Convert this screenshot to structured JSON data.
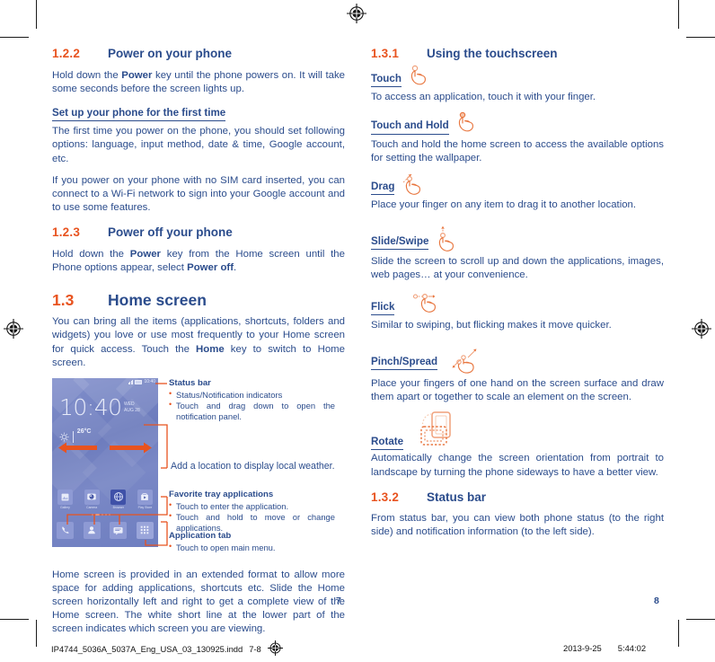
{
  "document": {
    "left_page_number": "7",
    "right_page_number": "8",
    "footer_filename": "IP4744_5036A_5037A_Eng_USA_03_130925.indd",
    "footer_pages": "7-8",
    "footer_date": "2013-9-25",
    "footer_time": "5:44:02"
  },
  "colors": {
    "heading_number": "#E8531F",
    "heading_title": "#2B4C8C",
    "body_text": "#2B4C8C",
    "accent_orange": "#E8531F",
    "phone_screen": "#6E7EC0"
  },
  "left_column": {
    "section_122": {
      "number": "1.2.2",
      "title": "Power on your phone",
      "para1_a": "Hold down the ",
      "para1_b": "Power",
      "para1_c": " key until the phone powers on. It will take some seconds before the screen lights up.",
      "subheading": "Set up your phone for the first time",
      "para2": "The first time you power on the phone, you should set following options: language, input method, date & time, Google account, etc.",
      "para3": "If you power on your phone with no SIM card inserted, you can connect to a Wi-Fi network to sign into your Google account and to use some features."
    },
    "section_123": {
      "number": "1.2.3",
      "title": "Power off your phone",
      "para1_a": "Hold down the ",
      "para1_b": "Power",
      "para1_c": " key from the Home screen until the Phone options appear, select ",
      "para1_d": "Power off",
      "para1_e": "."
    },
    "section_13": {
      "number": "1.3",
      "title": "Home screen",
      "para1_a": "You can bring all the items (applications, shortcuts, folders and widgets) you love or use most frequently to your Home screen for quick access. Touch the ",
      "para1_b": "Home",
      "para1_c": " key to switch to Home screen."
    },
    "closing_paragraph": "Home screen is provided in an extended format to allow more space for adding applications, shortcuts etc. Slide the Home screen horizontally left and right to get a complete view of the Home screen. The white short line at the lower part of the screen indicates which screen you are viewing."
  },
  "phone_mockup": {
    "status_time": "10:40",
    "clock": "10:40",
    "date_line1": "WED",
    "date_line2": "AUG 28",
    "weather_temp": "26°C",
    "weather_condition": "Sunny",
    "app_row": [
      {
        "label": "Gallery",
        "icon": "gallery-icon"
      },
      {
        "label": "Camera",
        "icon": "camera-icon"
      },
      {
        "label": "Browser",
        "icon": "browser-icon"
      },
      {
        "label": "Play Store",
        "icon": "play-store-icon"
      }
    ],
    "tray": [
      {
        "label": "Phone",
        "icon": "phone-icon"
      },
      {
        "label": "Contacts",
        "icon": "contacts-icon"
      },
      {
        "label": "Messaging",
        "icon": "messaging-icon"
      },
      {
        "label": "Application tab",
        "icon": "app-drawer-icon"
      }
    ]
  },
  "callouts": {
    "status_bar": {
      "title": "Status bar",
      "bullets": [
        "Status/Notification indicators",
        "Touch and drag down to open the notification panel."
      ]
    },
    "weather": {
      "text": "Add a location to display local weather."
    },
    "favorite_tray": {
      "title": "Favorite tray applications",
      "bullets": [
        "Touch to enter the application.",
        "Touch and hold to move or change applications."
      ]
    },
    "application_tab": {
      "title": "Application tab",
      "bullets": [
        "Touch to open main menu."
      ]
    }
  },
  "right_column": {
    "section_131": {
      "number": "1.3.1",
      "title": "Using the touchscreen"
    },
    "gestures": [
      {
        "name": "Touch",
        "icon": "touch-hand-icon",
        "description": "To access an application, touch it with your finger."
      },
      {
        "name": "Touch and Hold",
        "icon": "touch-hold-hand-icon",
        "description": "Touch and hold the home screen to access the available options for setting the wallpaper."
      },
      {
        "name": "Drag",
        "icon": "drag-hand-icon",
        "description": "Place your finger on any item to drag it to another location."
      },
      {
        "name": "Slide/Swipe",
        "icon": "slide-hand-icon",
        "description": "Slide the screen to scroll up and down the applications, images, web pages… at your convenience."
      },
      {
        "name": "Flick",
        "icon": "flick-hand-icon",
        "description": "Similar to swiping, but flicking makes it move quicker."
      },
      {
        "name": "Pinch/Spread",
        "icon": "pinch-spread-hand-icon",
        "description": "Place your fingers of one hand on the screen surface and draw them apart or together to scale an element on the screen."
      },
      {
        "name": "Rotate",
        "icon": "rotate-phone-icon",
        "description": "Automatically change the screen orientation from portrait to landscape by turning the phone sideways to have a better view."
      }
    ],
    "section_132": {
      "number": "1.3.2",
      "title": "Status bar",
      "paragraph": "From status bar, you can view both phone status (to the right side) and notification information (to the left side)."
    }
  }
}
